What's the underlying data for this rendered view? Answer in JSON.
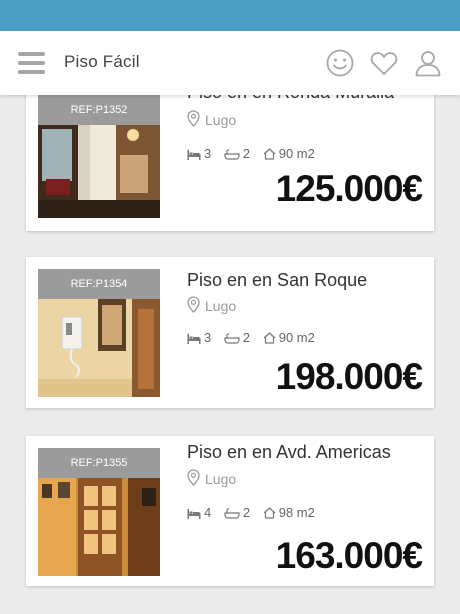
{
  "app": {
    "title": "Piso Fácil"
  },
  "header_icons": [
    "menu-icon",
    "smiley-icon",
    "heart-icon",
    "user-icon"
  ],
  "colors": {
    "status_bar": "#4a9dc5",
    "ref_badge": "#9b9b9b",
    "background": "#ebebeb"
  },
  "listings": [
    {
      "ref": "REF:P1352",
      "title": "Piso en en Ronda Muralla",
      "location": "Lugo",
      "bedrooms": "3",
      "bathrooms": "2",
      "area": "90 m2",
      "price": "125.000€"
    },
    {
      "ref": "REF:P1354",
      "title": "Piso en en San Roque",
      "location": "Lugo",
      "bedrooms": "3",
      "bathrooms": "2",
      "area": "90 m2",
      "price": "198.000€"
    },
    {
      "ref": "REF:P1355",
      "title": "Piso en en Avd. Americas",
      "location": "Lugo",
      "bedrooms": "4",
      "bathrooms": "2",
      "area": "98 m2",
      "price": "163.000€"
    }
  ]
}
